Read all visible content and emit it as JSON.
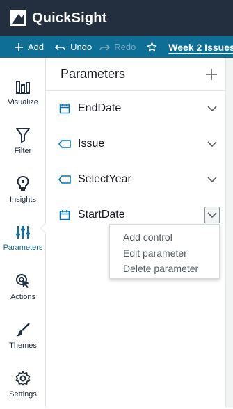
{
  "app": {
    "title": "QuickSight"
  },
  "toolbar": {
    "add_label": "Add",
    "undo_label": "Undo",
    "redo_label": "Redo",
    "sheet_title": "Week 2 Issues"
  },
  "rail": {
    "items": [
      {
        "label": "Visualize",
        "icon": "bar-chart-icon"
      },
      {
        "label": "Filter",
        "icon": "funnel-icon"
      },
      {
        "label": "Insights",
        "icon": "lightbulb-icon"
      },
      {
        "label": "Parameters",
        "icon": "sliders-icon",
        "active": true
      },
      {
        "label": "Actions",
        "icon": "cursor-click-icon"
      },
      {
        "label": "Themes",
        "icon": "paintbrush-icon"
      },
      {
        "label": "Settings",
        "icon": "gear-icon"
      }
    ]
  },
  "panel": {
    "title": "Parameters",
    "parameters": [
      {
        "name": "EndDate",
        "type_icon": "calendar-icon"
      },
      {
        "name": "Issue",
        "type_icon": "tag-icon"
      },
      {
        "name": "SelectYear",
        "type_icon": "tag-icon"
      },
      {
        "name": "StartDate",
        "type_icon": "calendar-icon",
        "menu_open": true
      }
    ]
  },
  "menu": {
    "items": [
      "Add control",
      "Edit parameter",
      "Delete parameter"
    ]
  },
  "colors": {
    "header_bg": "#232f3e",
    "toolbar_bg": "#0f6e95",
    "accent": "#0073bb",
    "text": "#16191f"
  }
}
